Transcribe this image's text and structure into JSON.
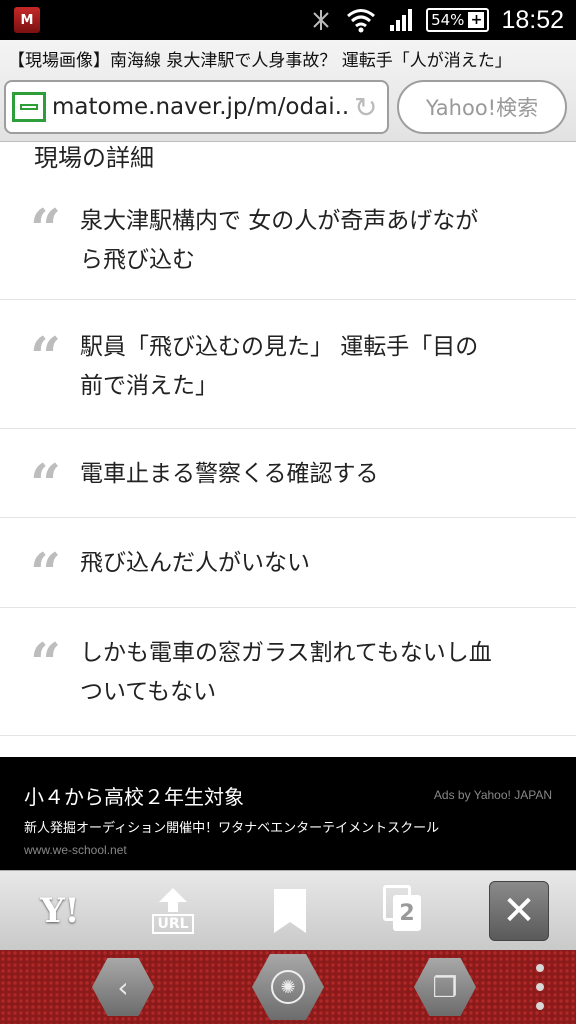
{
  "status_bar": {
    "app_icon_letter": "M",
    "battery_percent": "54%",
    "time": "18:52"
  },
  "browser": {
    "page_title": "【現場画像】南海線 泉大津駅で人身事故？ 運転手「人が消えた」",
    "url": "matome.naver.jp/m/odai...",
    "search_placeholder": "Yahoo!検索"
  },
  "content": {
    "section_heading": "現場の詳細",
    "quote_mark": "“",
    "quotes": [
      {
        "line1": "泉大津駅構内で  女の人が奇声あげなが",
        "line2": "ら飛び込む"
      },
      {
        "line1": "駅員「飛び込むの見た」  運転手「目の",
        "line2": "前で消えた」"
      },
      {
        "line1": "電車止まる警察くる確認する",
        "line2": ""
      },
      {
        "line1": "飛び込んだ人がいない",
        "line2": ""
      },
      {
        "line1": "しかも電車の窓ガラス割れてもないし血",
        "line2": "ついてもない"
      }
    ]
  },
  "ad": {
    "title": "小４から高校２年生対象",
    "by": "Ads by Yahoo! JAPAN",
    "description": "新人発掘オーディション開催中！ワタナベエンターテイメントスクール",
    "url": "www.we-school.net"
  },
  "toolbar": {
    "yahoo_label": "Y!",
    "url_label": "URL",
    "tabs_count": "2",
    "close_label": "✕"
  },
  "navbar": {
    "back_glyph": "‹",
    "recent_glyph": "❐"
  }
}
